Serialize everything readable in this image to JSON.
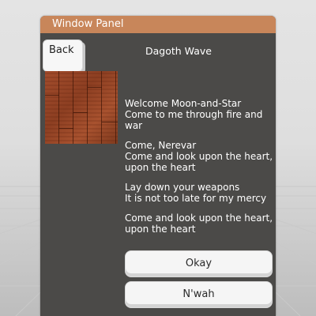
{
  "window": {
    "title": "Window Panel"
  },
  "back_button": {
    "label": "Back"
  },
  "dialog": {
    "heading": "Dagoth Wave",
    "image": {
      "icon": "wood-texture-image"
    },
    "paragraphs": [
      [
        "Welcome Moon-and-Star",
        "Come to me through fire and war"
      ],
      [
        "Come, Nerevar",
        "Come and look upon the heart, upon the heart"
      ],
      [
        "Lay down your weapons",
        "It is not too late for my mercy"
      ],
      [
        "Come and look upon the heart, upon the heart"
      ]
    ]
  },
  "buttons": {
    "okay": "Okay",
    "nwah": "N'wah"
  },
  "colors": {
    "titlebar": "#c8865a",
    "panel": "#4b4a48",
    "button": "#f5f5f5"
  }
}
